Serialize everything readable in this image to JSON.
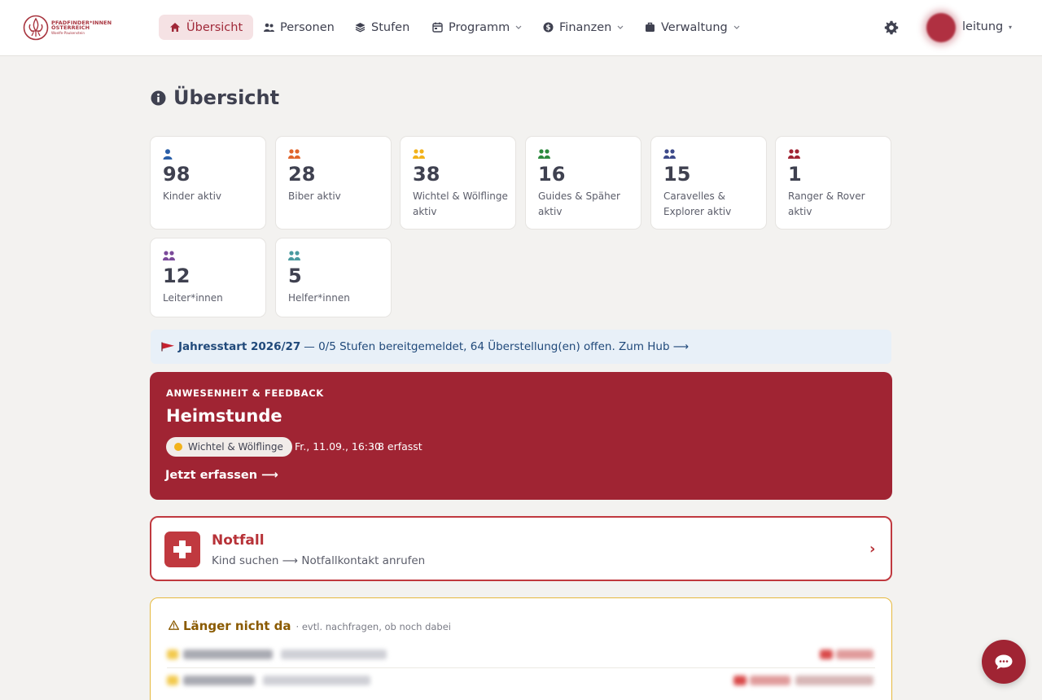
{
  "brand": {
    "line1": "PFADFINDER*INNEN",
    "line2": "ÖSTERREICH",
    "line3": "Woelfe-Paukenstein",
    "color": "#a8353f"
  },
  "nav": {
    "items": [
      {
        "label": "Übersicht",
        "icon": "home-icon",
        "active": true
      },
      {
        "label": "Personen",
        "icon": "users-icon"
      },
      {
        "label": "Stufen",
        "icon": "layers-icon"
      },
      {
        "label": "Programm",
        "icon": "calendar-icon",
        "dropdown": true
      },
      {
        "label": "Finanzen",
        "icon": "dollar-icon",
        "dropdown": true
      },
      {
        "label": "Verwaltung",
        "icon": "briefcase-icon",
        "dropdown": true
      }
    ],
    "settings_icon": "gear-icon",
    "user": {
      "name": "leitung",
      "caret": "▾"
    }
  },
  "page": {
    "title": "Übersicht",
    "icon": "info-icon"
  },
  "stats": [
    {
      "value": "98",
      "label": "Kinder aktiv",
      "color": "#2b5fa8",
      "icon": "user-icon"
    },
    {
      "value": "28",
      "label": "Biber aktiv",
      "color": "#e0652c",
      "icon": "group-icon"
    },
    {
      "value": "38",
      "label": "Wichtel & Wölflinge aktiv",
      "color": "#f2b21b",
      "icon": "group-icon"
    },
    {
      "value": "16",
      "label": "Guides & Späher aktiv",
      "color": "#2c8a3e",
      "icon": "group-icon"
    },
    {
      "value": "15",
      "label": "Caravelles & Explorer aktiv",
      "color": "#3d4a8a",
      "icon": "group-icon"
    },
    {
      "value": "1",
      "label": "Ranger & Rover aktiv",
      "color": "#a02433",
      "icon": "group-icon"
    },
    {
      "value": "12",
      "label": "Leiter*innen",
      "color": "#7b4a9a",
      "icon": "group-icon"
    },
    {
      "value": "5",
      "label": "Helfer*innen",
      "color": "#4a9aa0",
      "icon": "group-icon"
    }
  ],
  "banner": {
    "flag_icon": "flag-icon",
    "strong": "Jahresstart 2026/27",
    "text": "— 0/5 Stufen bereitgemeldet, 64 Überstellung(en) offen. Zum Hub ⟶"
  },
  "attendance": {
    "label": "ANWESENHEIT & FEEDBACK",
    "title": "Heimstunde",
    "chip": "Wichtel & Wölflinge",
    "chip_color": "#f2b21b",
    "date": "Fr., 11.09., 16:30",
    "count": "· 8 erfasst",
    "cta": "Jetzt erfassen ⟶"
  },
  "emergency": {
    "title": "Notfall",
    "subtitle": "Kind suchen ⟶ Notfallkontakt anrufen",
    "chevron": "›"
  },
  "absent": {
    "icon": "warning-icon",
    "title": "Länger nicht da",
    "subtitle": "· evtl. nachfragen, ob noch dabei"
  },
  "chat": {
    "icon": "chat-icon"
  }
}
